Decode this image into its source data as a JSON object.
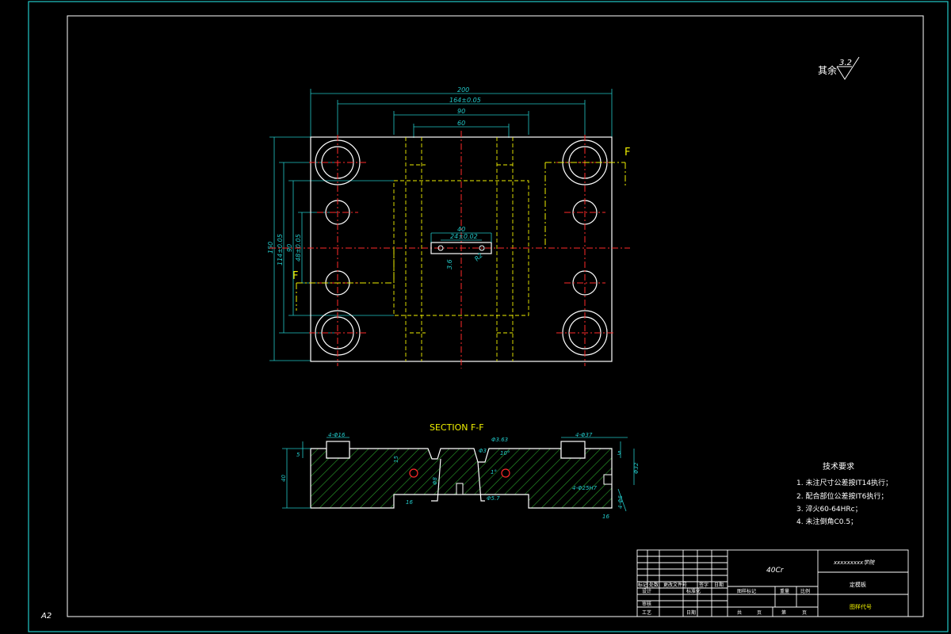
{
  "sheet": {
    "size_code": "A2",
    "colors": {
      "background": "#000000",
      "border_cyan": "#22c7c7",
      "outline_white": "#ffffff",
      "center_red": "#ff2a2a",
      "hidden_yellow": "#f0f000",
      "dimension_cyan": "#22c7c7",
      "hatch_green": "#2aa02a",
      "title_yellow": "#f0f000"
    }
  },
  "roughness": {
    "label": "其余",
    "value": "3.2"
  },
  "plan_view": {
    "dimensions": {
      "overall_width": "200",
      "bolt_spacing_x": "164±0.05",
      "inner_width": "90",
      "slot_span": "60",
      "slot_length": "40",
      "slot_center": "24±0.02",
      "overall_height": "150",
      "bolt_spacing_y": "114±0.05",
      "inner_height": "90",
      "pin_spacing_y": "48±0.05",
      "slot_depth": "3.6",
      "radius": "R2"
    },
    "section_marks": {
      "upper": "F",
      "lower": "F"
    }
  },
  "section_view": {
    "title": "SECTION F-F",
    "dimensions": {
      "left_counterbore": "4-Φ16",
      "depth_left": "5",
      "total_height": "40",
      "hole_top": "Φ3.63",
      "hole_sub": "Φ3",
      "angle": "10°",
      "step_height": "15",
      "taper": "1°",
      "side_dim": "Φ8",
      "bottom_hole": "Φ5.7",
      "bottom_recess": "16",
      "right_counterbore": "4-Φ37",
      "right_depth": "5",
      "right_height": "Φ32",
      "thru_hole": "4-Φ25H7",
      "right_bottom": "4-Φ6",
      "bottom_right": "16"
    }
  },
  "technical_requirements": {
    "title": "技术要求",
    "items": [
      "1. 未注尺寸公差按IT14执行；",
      "2. 配合部位公差按IT6执行；",
      "3. 淬火60-64HRc；",
      "4. 未注倒角C0.5；"
    ]
  },
  "title_block": {
    "material": "40Cr",
    "institution": "xxxxxxxxx学院",
    "part_name": "定模板",
    "drawing_number": "图样代号",
    "headers_row1": [
      "标记",
      "处数",
      "更改文件号",
      "签字",
      "日期"
    ],
    "headers_row2": [
      "设计",
      "",
      "标准化",
      "",
      ""
    ],
    "headers_row3": [
      "审核",
      "",
      "",
      "",
      ""
    ],
    "headers_row4": [
      "工艺",
      "",
      "日期",
      "",
      ""
    ],
    "stage_headers": [
      "图样标记",
      "重量",
      "比例"
    ],
    "sheet_headers": [
      "共",
      "页",
      "第",
      "页"
    ]
  }
}
